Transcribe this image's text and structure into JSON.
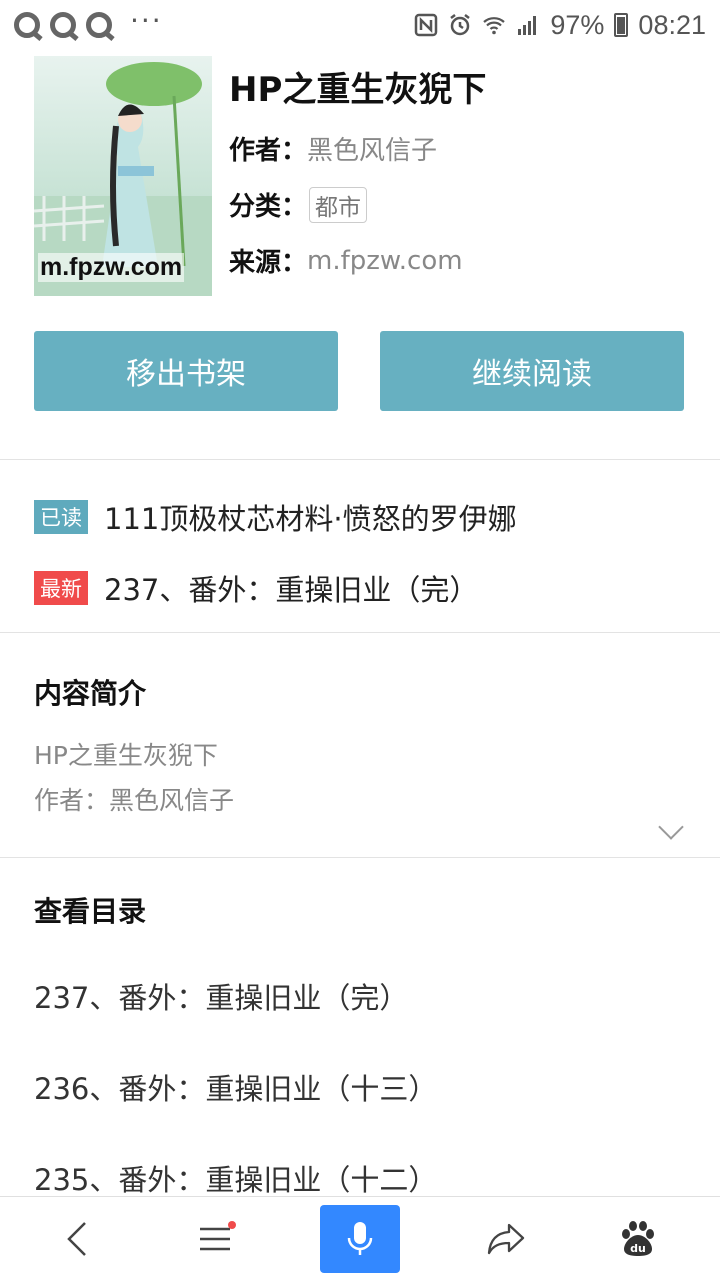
{
  "status_bar": {
    "battery": "97%",
    "time": "08:21",
    "dots": "···"
  },
  "book": {
    "title": "HP之重生灰猊下",
    "cover_watermark": "m.fpzw.com",
    "author_label": "作者：",
    "author": "黑色风信子",
    "category_label": "分类：",
    "category": "都市",
    "source_label": "来源：",
    "source": "m.fpzw.com"
  },
  "actions": {
    "remove": "移出书架",
    "continue": "继续阅读"
  },
  "progress": {
    "read_badge": "已读",
    "read_chapter": "111顶极杖芯材料·愤怒的罗伊娜",
    "latest_badge": "最新",
    "latest_chapter": "237、番外：重操旧业（完）"
  },
  "intro": {
    "heading": "内容简介",
    "line1": "HP之重生灰猊下",
    "line2": "作者：黑色风信子"
  },
  "toc": {
    "heading": "查看目录",
    "items": [
      "237、番外：重操旧业（完）",
      "236、番外：重操旧业（十三）",
      "235、番外：重操旧业（十二）"
    ]
  },
  "colors": {
    "accent": "#67b0c1",
    "read_badge": "#5faabd",
    "latest_badge": "#f04b4b",
    "mic": "#3388ff"
  },
  "icons": [
    "back-icon",
    "menu-icon",
    "mic-icon",
    "share-icon",
    "baidu-paw-icon"
  ]
}
